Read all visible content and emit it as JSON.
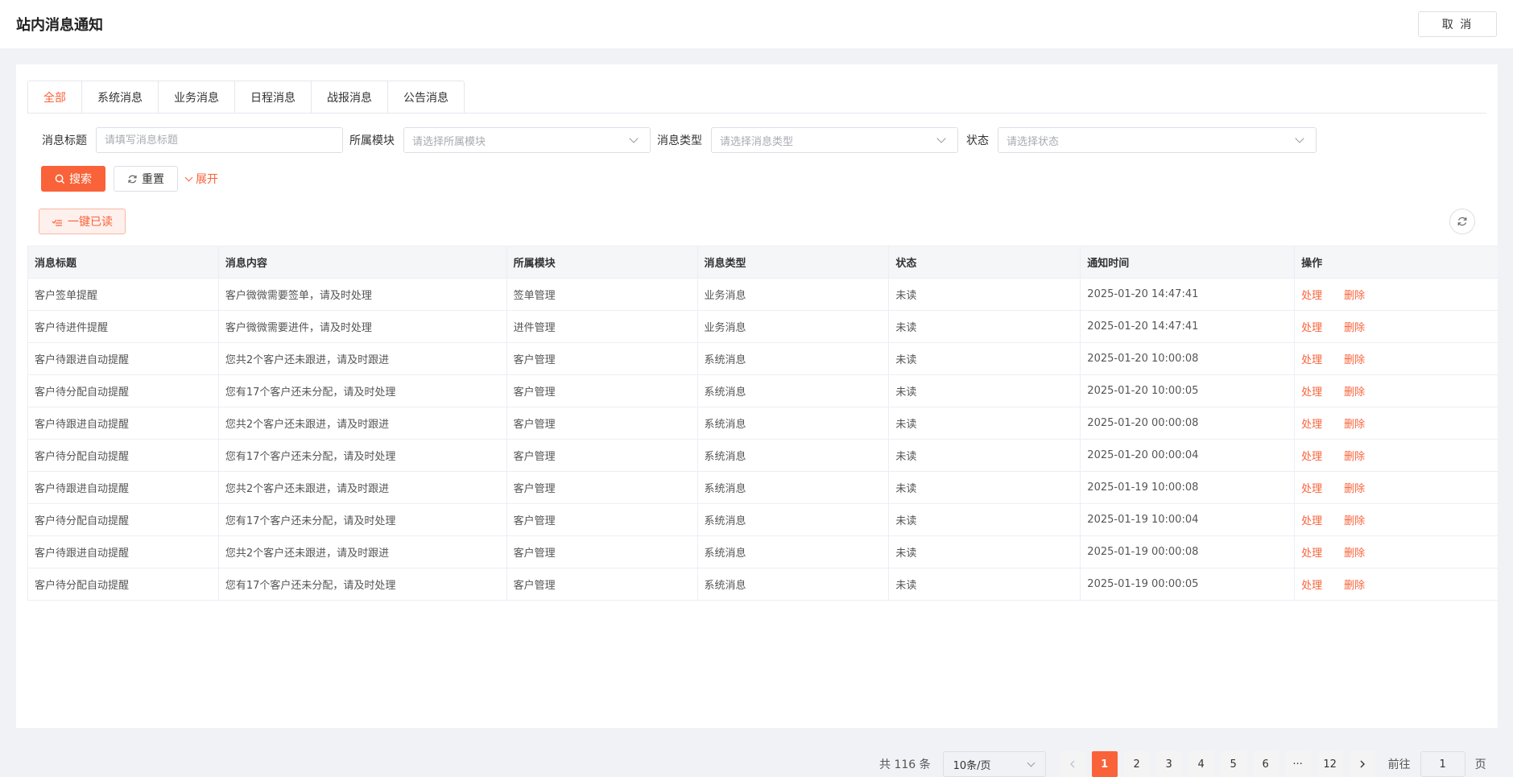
{
  "header": {
    "title": "站内消息通知",
    "cancel_label": "取 消"
  },
  "tabs": [
    "全部",
    "系统消息",
    "业务消息",
    "日程消息",
    "战报消息",
    "公告消息"
  ],
  "active_tab": 0,
  "filters": {
    "title_label": "消息标题",
    "title_placeholder": "请填写消息标题",
    "module_label": "所属模块",
    "module_placeholder": "请选择所属模块",
    "type_label": "消息类型",
    "type_placeholder": "请选择消息类型",
    "status_label": "状态",
    "status_placeholder": "请选择状态"
  },
  "actions": {
    "search": "搜索",
    "reset": "重置",
    "expand": "展开",
    "read_all": "一键已读"
  },
  "table": {
    "headers": [
      "消息标题",
      "消息内容",
      "所属模块",
      "消息类型",
      "状态",
      "通知时间",
      "操作"
    ],
    "op_handle": "处理",
    "op_delete": "删除",
    "rows": [
      [
        "客户签单提醒",
        "客户微微需要签单，请及时处理",
        "签单管理",
        "业务消息",
        "未读",
        "2025-01-20 14:47:41"
      ],
      [
        "客户待进件提醒",
        "客户微微需要进件，请及时处理",
        "进件管理",
        "业务消息",
        "未读",
        "2025-01-20 14:47:41"
      ],
      [
        "客户待跟进自动提醒",
        "您共2个客户还未跟进，请及时跟进",
        "客户管理",
        "系统消息",
        "未读",
        "2025-01-20 10:00:08"
      ],
      [
        "客户待分配自动提醒",
        "您有17个客户还未分配，请及时处理",
        "客户管理",
        "系统消息",
        "未读",
        "2025-01-20 10:00:05"
      ],
      [
        "客户待跟进自动提醒",
        "您共2个客户还未跟进，请及时跟进",
        "客户管理",
        "系统消息",
        "未读",
        "2025-01-20 00:00:08"
      ],
      [
        "客户待分配自动提醒",
        "您有17个客户还未分配，请及时处理",
        "客户管理",
        "系统消息",
        "未读",
        "2025-01-20 00:00:04"
      ],
      [
        "客户待跟进自动提醒",
        "您共2个客户还未跟进，请及时跟进",
        "客户管理",
        "系统消息",
        "未读",
        "2025-01-19 10:00:08"
      ],
      [
        "客户待分配自动提醒",
        "您有17个客户还未分配，请及时处理",
        "客户管理",
        "系统消息",
        "未读",
        "2025-01-19 10:00:04"
      ],
      [
        "客户待跟进自动提醒",
        "您共2个客户还未跟进，请及时跟进",
        "客户管理",
        "系统消息",
        "未读",
        "2025-01-19 00:00:08"
      ],
      [
        "客户待分配自动提醒",
        "您有17个客户还未分配，请及时处理",
        "客户管理",
        "系统消息",
        "未读",
        "2025-01-19 00:00:05"
      ]
    ]
  },
  "pagination": {
    "total_text": "共 116 条",
    "page_size": "10条/页",
    "pages": [
      "1",
      "2",
      "3",
      "4",
      "5",
      "6",
      "···",
      "12"
    ],
    "current": "1",
    "goto_label": "前往",
    "goto_value": "1",
    "page_suffix": "页"
  },
  "colors": {
    "accent": "#fa6239",
    "accent_light": "#fef0ec"
  }
}
